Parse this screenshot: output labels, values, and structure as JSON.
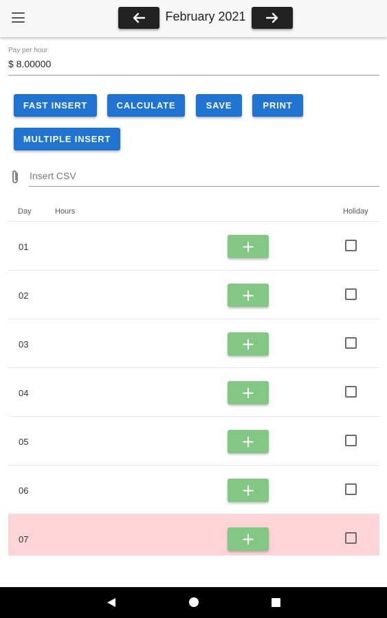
{
  "header": {
    "title": "February 2021",
    "menu_icon": "hamburger-menu-icon",
    "prev_icon": "arrow-left-icon",
    "next_icon": "arrow-right-icon"
  },
  "pay": {
    "label": "Pay per hour",
    "value": "$ 8.00000"
  },
  "buttons": {
    "fast_insert": "FAST INSERT",
    "calculate": "CALCULATE",
    "save": "SAVE",
    "print": "PRINT",
    "multiple_insert": "MULTIPLE INSERT",
    "color": "#1e74d0"
  },
  "csv": {
    "placeholder": "Insert CSV",
    "icon": "paperclip-icon"
  },
  "table": {
    "headers": {
      "day": "Day",
      "hours": "Hours",
      "holiday": "Holiday"
    },
    "add_label": "+",
    "add_color": "#82c784",
    "holiday_row_color": "#fdd4d8",
    "rows": [
      {
        "day": "01",
        "holiday": false
      },
      {
        "day": "02",
        "holiday": false
      },
      {
        "day": "03",
        "holiday": false
      },
      {
        "day": "04",
        "holiday": false
      },
      {
        "day": "05",
        "holiday": false
      },
      {
        "day": "06",
        "holiday": false
      },
      {
        "day": "07",
        "holiday": false,
        "highlighted": true
      }
    ]
  },
  "system_nav": {
    "back_icon": "back-triangle-icon",
    "home_icon": "home-circle-icon",
    "recents_icon": "recents-square-icon"
  }
}
